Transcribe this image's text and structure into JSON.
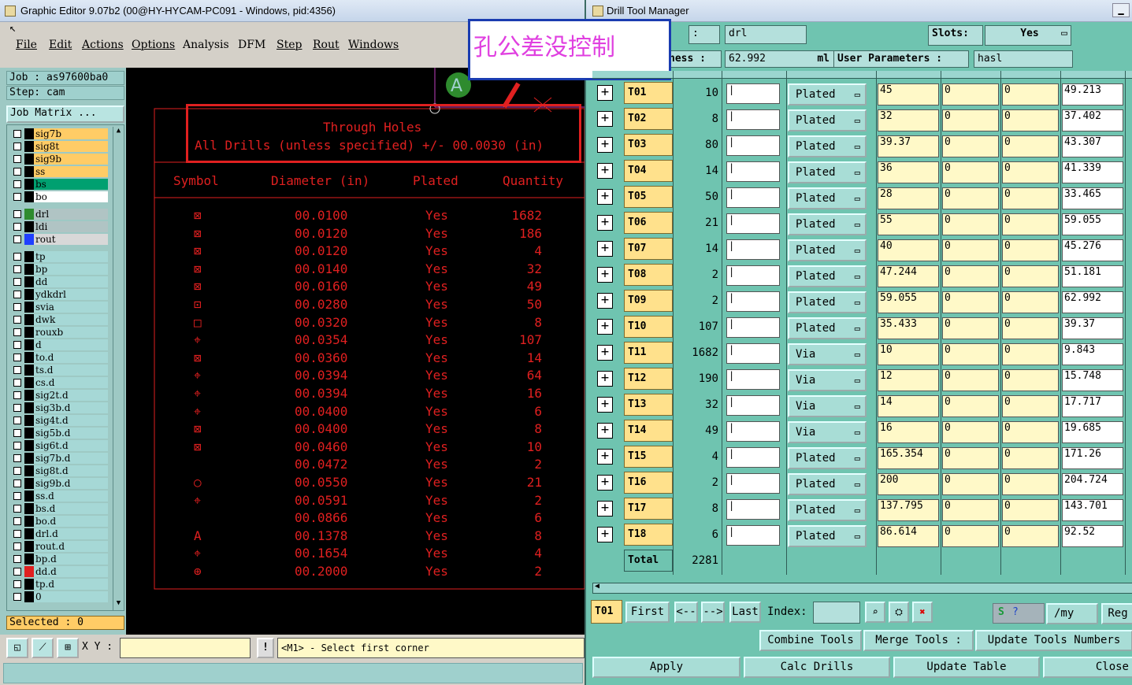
{
  "ge": {
    "title": "Graphic Editor 9.07b2 (00@HY-HYCAM-PC091 - Windows, pid:4356)",
    "menu": [
      "File",
      "Edit",
      "Actions",
      "Options",
      "Analysis",
      "DFM",
      "Step",
      "Rout",
      "Windows"
    ],
    "job_label": "Job : as97600ba0",
    "step_label": "Step: cam",
    "job_matrix": "Job Matrix ...",
    "layers": [
      {
        "name": "sig7b",
        "color": "#ffcc66"
      },
      {
        "name": "sig8t",
        "color": "#ffcc66"
      },
      {
        "name": "sig9b",
        "color": "#ffcc66"
      },
      {
        "name": "ss",
        "color": "#ffcc66"
      },
      {
        "name": "bs",
        "color": "#00a070"
      },
      {
        "name": "bo",
        "color": "#ffffff"
      },
      {
        "name": "drl",
        "color": "#b0c4c4",
        "sw": "#2e8b2e"
      },
      {
        "name": "ldi",
        "color": "#b0c4c4"
      },
      {
        "name": "rout",
        "color": "#d8d8d8",
        "sw": "#1f3fff"
      },
      {
        "name": "tp"
      },
      {
        "name": "bp"
      },
      {
        "name": "dd"
      },
      {
        "name": "ydkdrl"
      },
      {
        "name": "svia"
      },
      {
        "name": "dwk"
      },
      {
        "name": "rouxb"
      },
      {
        "name": "d"
      },
      {
        "name": "to.d"
      },
      {
        "name": "ts.d"
      },
      {
        "name": "cs.d"
      },
      {
        "name": "sig2t.d"
      },
      {
        "name": "sig3b.d"
      },
      {
        "name": "sig4t.d"
      },
      {
        "name": "sig5b.d"
      },
      {
        "name": "sig6t.d"
      },
      {
        "name": "sig7b.d"
      },
      {
        "name": "sig8t.d"
      },
      {
        "name": "sig9b.d"
      },
      {
        "name": "ss.d"
      },
      {
        "name": "bs.d"
      },
      {
        "name": "bo.d"
      },
      {
        "name": "drl.d"
      },
      {
        "name": "rout.d"
      },
      {
        "name": "bp.d"
      },
      {
        "name": "dd.d",
        "sw": "#e02020"
      },
      {
        "name": "tp.d"
      },
      {
        "name": "0"
      }
    ],
    "selected": "Selected : 0",
    "xy_label": "X Y :",
    "prompt": "<M1> - Select first corner"
  },
  "canvas": {
    "heading1": "Through Holes",
    "heading2": "All Drills (unless specified) +/- 00.0030 (in)",
    "col_symbol": "Symbol",
    "col_diameter": "Diameter (in)",
    "col_plated": "Plated",
    "col_quantity": "Quantity",
    "marker": "A",
    "rows": [
      {
        "sym": "⊠",
        "d": "00.0100",
        "p": "Yes",
        "q": "1682"
      },
      {
        "sym": "⊠",
        "d": "00.0120",
        "p": "Yes",
        "q": "186"
      },
      {
        "sym": "⊠",
        "d": "00.0120",
        "p": "Yes",
        "q": "4"
      },
      {
        "sym": "⊠",
        "d": "00.0140",
        "p": "Yes",
        "q": "32"
      },
      {
        "sym": "⊠",
        "d": "00.0160",
        "p": "Yes",
        "q": "49"
      },
      {
        "sym": "⊡",
        "d": "00.0280",
        "p": "Yes",
        "q": "50"
      },
      {
        "sym": "□",
        "d": "00.0320",
        "p": "Yes",
        "q": "8"
      },
      {
        "sym": "⌖",
        "d": "00.0354",
        "p": "Yes",
        "q": "107"
      },
      {
        "sym": "⊠",
        "d": "00.0360",
        "p": "Yes",
        "q": "14"
      },
      {
        "sym": "⌖",
        "d": "00.0394",
        "p": "Yes",
        "q": "64"
      },
      {
        "sym": "⌖",
        "d": "00.0394",
        "p": "Yes",
        "q": "16"
      },
      {
        "sym": "⌖",
        "d": "00.0400",
        "p": "Yes",
        "q": "6"
      },
      {
        "sym": "⊠",
        "d": "00.0400",
        "p": "Yes",
        "q": "8"
      },
      {
        "sym": "⊠",
        "d": "00.0460",
        "p": "Yes",
        "q": "10"
      },
      {
        "sym": "",
        "d": "00.0472",
        "p": "Yes",
        "q": "2"
      },
      {
        "sym": "○",
        "d": "00.0550",
        "p": "Yes",
        "q": "21"
      },
      {
        "sym": "⌖",
        "d": "00.0591",
        "p": "Yes",
        "q": "2"
      },
      {
        "sym": "",
        "d": "00.0866",
        "p": "Yes",
        "q": "6"
      },
      {
        "sym": "A",
        "d": "00.1378",
        "p": "Yes",
        "q": "8"
      },
      {
        "sym": "⌖",
        "d": "00.1654",
        "p": "Yes",
        "q": "4"
      },
      {
        "sym": "⊕",
        "d": "00.2000",
        "p": "Yes",
        "q": "2"
      }
    ]
  },
  "dtm": {
    "title": "Drill Tool Manager",
    "layer_value": "drl",
    "slots_label": "Slots:",
    "slots_value": "Yes",
    "ness_label": "ness :",
    "ness_value": "62.992",
    "ness_unit": "ml",
    "user_params_label": "User Parameters :",
    "user_params_value": "hasl",
    "annotation": "孔公差没控制",
    "tools": [
      {
        "id": "T01",
        "count": "10",
        "type": "Plated",
        "size": "45",
        "m1": "0",
        "m2": "0",
        "fin": "49.213"
      },
      {
        "id": "T02",
        "count": "8",
        "type": "Plated",
        "size": "32",
        "m1": "0",
        "m2": "0",
        "fin": "37.402"
      },
      {
        "id": "T03",
        "count": "80",
        "type": "Plated",
        "size": "39.37",
        "m1": "0",
        "m2": "0",
        "fin": "43.307"
      },
      {
        "id": "T04",
        "count": "14",
        "type": "Plated",
        "size": "36",
        "m1": "0",
        "m2": "0",
        "fin": "41.339"
      },
      {
        "id": "T05",
        "count": "50",
        "type": "Plated",
        "size": "28",
        "m1": "0",
        "m2": "0",
        "fin": "33.465"
      },
      {
        "id": "T06",
        "count": "21",
        "type": "Plated",
        "size": "55",
        "m1": "0",
        "m2": "0",
        "fin": "59.055"
      },
      {
        "id": "T07",
        "count": "14",
        "type": "Plated",
        "size": "40",
        "m1": "0",
        "m2": "0",
        "fin": "45.276"
      },
      {
        "id": "T08",
        "count": "2",
        "type": "Plated",
        "size": "47.244",
        "m1": "0",
        "m2": "0",
        "fin": "51.181"
      },
      {
        "id": "T09",
        "count": "2",
        "type": "Plated",
        "size": "59.055",
        "m1": "0",
        "m2": "0",
        "fin": "62.992"
      },
      {
        "id": "T10",
        "count": "107",
        "type": "Plated",
        "size": "35.433",
        "m1": "0",
        "m2": "0",
        "fin": "39.37"
      },
      {
        "id": "T11",
        "count": "1682",
        "type": "Via",
        "size": "10",
        "m1": "0",
        "m2": "0",
        "fin": "9.843"
      },
      {
        "id": "T12",
        "count": "190",
        "type": "Via",
        "size": "12",
        "m1": "0",
        "m2": "0",
        "fin": "15.748"
      },
      {
        "id": "T13",
        "count": "32",
        "type": "Via",
        "size": "14",
        "m1": "0",
        "m2": "0",
        "fin": "17.717"
      },
      {
        "id": "T14",
        "count": "49",
        "type": "Via",
        "size": "16",
        "m1": "0",
        "m2": "0",
        "fin": "19.685"
      },
      {
        "id": "T15",
        "count": "4",
        "type": "Plated",
        "size": "165.354",
        "m1": "0",
        "m2": "0",
        "fin": "171.26"
      },
      {
        "id": "T16",
        "count": "2",
        "type": "Plated",
        "size": "200",
        "m1": "0",
        "m2": "0",
        "fin": "204.724"
      },
      {
        "id": "T17",
        "count": "8",
        "type": "Plated",
        "size": "137.795",
        "m1": "0",
        "m2": "0",
        "fin": "143.701"
      },
      {
        "id": "T18",
        "count": "6",
        "type": "Plated",
        "size": "86.614",
        "m1": "0",
        "m2": "0",
        "fin": "92.52"
      }
    ],
    "total_label": "Total",
    "total_value": "2281",
    "current_tool": "T01",
    "nav": {
      "first": "First",
      "prev": "<--",
      "next": "-->",
      "last": "Last",
      "index": "Index:"
    },
    "my_value": "/my",
    "reg_label": "Reg",
    "combine": "Combine Tools",
    "merge": "Merge Tools :",
    "update_numbers": "Update Tools Numbers",
    "apply": "Apply",
    "calc": "Calc Drills",
    "update_table": "Update Table",
    "close": "Close"
  }
}
